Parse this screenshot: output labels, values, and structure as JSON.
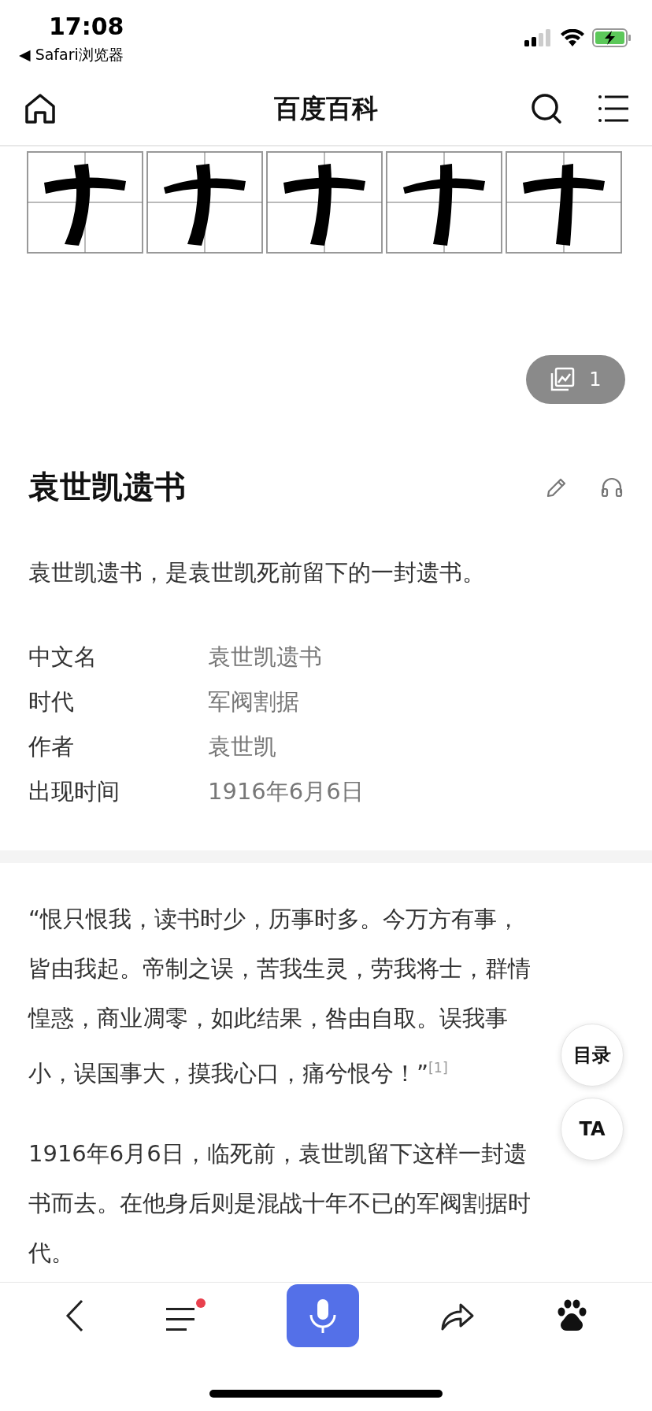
{
  "status_bar": {
    "time": "17:08",
    "back_app": "◀ Safari浏览器"
  },
  "nav": {
    "title": "百度百科"
  },
  "banner": {
    "kind": "picture",
    "gallery_count": "1"
  },
  "article": {
    "title": "袁世凯遗书",
    "summary": "袁世凯遗书，是袁世凯死前留下的一封遗书。",
    "info": [
      {
        "label": "中文名",
        "value": "袁世凯遗书"
      },
      {
        "label": "时代",
        "value": "军阀割据"
      },
      {
        "label": "作者",
        "value": "袁世凯"
      },
      {
        "label": "出现时间",
        "value": "1916年6月6日"
      }
    ]
  },
  "body": {
    "paragraphs": [
      "“恨只恨我，读书时少，历事时多。今万方有事，皆由我起。帝制之误，苦我生灵，劳我将士，群情惶惑，商业凋零，如此结果，咎由自取。误我事小，误国事大，摸我心口，痛兮恨兮！”$^{[1]}$",
      "1916年6月6日，临死前，袁世凯留下这样一封遗书而去。在他身后则是混战十年不已的军阀割据时代。"
    ]
  },
  "float_buttons": [
    {
      "label": "目录"
    },
    {
      "label": "TA"
    }
  ],
  "bottom_bar": {
    "menu_notification": true
  }
}
